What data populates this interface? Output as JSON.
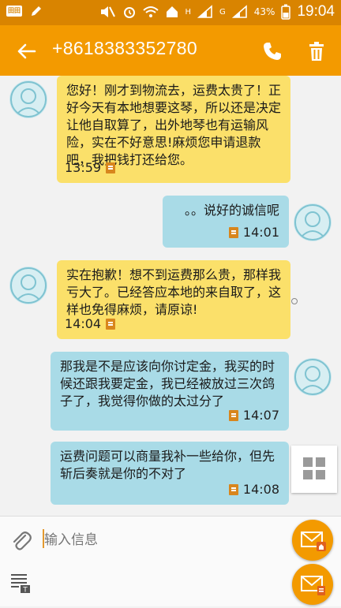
{
  "status": {
    "battery": "43%",
    "time": "19:04",
    "network_h": "H",
    "network_g": "G"
  },
  "header": {
    "title": "+8618383352780"
  },
  "messages": [
    {
      "dir": "in",
      "text": "您好！刚才到物流去，运费太贵了！正好今天有本地想要这琴，所以还是决定让他自取算了，出外地琴也有运输风险，实在不好意思!麻烦您申请退款吧，我把钱打还给您。",
      "time": "13:59"
    },
    {
      "dir": "out",
      "text": "。。说好的诚信呢",
      "time": "14:01"
    },
    {
      "dir": "in",
      "text": "实在抱歉！想不到运费那么贵，那样我亏大了。已经答应本地的来自取了，这样也免得麻烦，请原谅!",
      "time": "14:04"
    },
    {
      "dir": "out",
      "text": "那我是不是应该向你讨定金，我买的时候还跟我要定金，我已经被放过三次鸽子了，我觉得你做的太过分了",
      "time": "14:07"
    },
    {
      "dir": "out",
      "text": "运费问题可以商量我补一些给你，但先斩后奏就是你的不对了",
      "time": "14:08"
    }
  ],
  "composer": {
    "placeholder": "输入信息"
  },
  "colors": {
    "accent": "#f39a00",
    "statusbar": "#d98400",
    "incoming": "#fbe06a",
    "outgoing": "#a9dbe7"
  }
}
